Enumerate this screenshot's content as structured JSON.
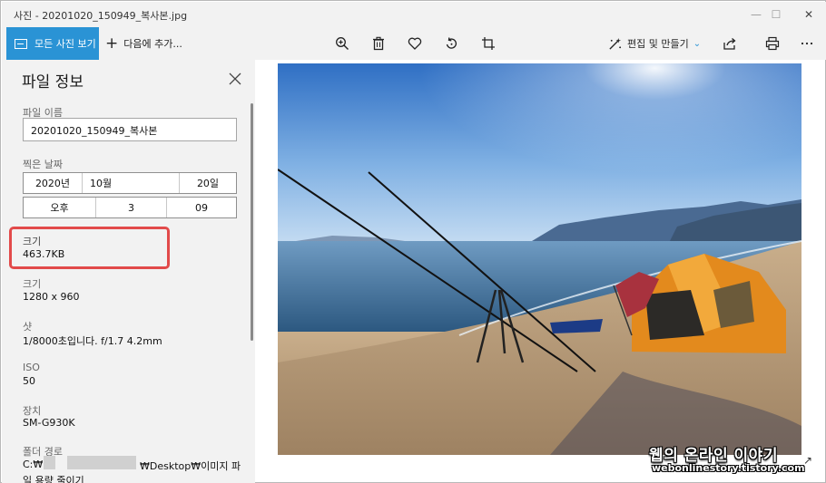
{
  "window": {
    "title": "사진 - 20201020_150949_복사본.jpg",
    "minimize_glyph": "—",
    "maximize_glyph": "☐",
    "close_glyph": "✕"
  },
  "toolbar": {
    "all_photos_label": "모든 사진 보기",
    "add_label": "다음에 추가...",
    "edit_label": "편집 및 만들기",
    "icons": [
      "zoom-icon",
      "delete-icon",
      "favorite-heart-icon",
      "rotate-icon",
      "crop-icon",
      "edit-create-icon",
      "share-icon",
      "print-icon",
      "more-icon"
    ],
    "accent": "#2a93d5"
  },
  "info_panel": {
    "title": "파일 정보",
    "file_name": {
      "label": "파일 이름",
      "value": "20201020_150949_복사본"
    },
    "date_taken": {
      "label": "찍은 날짜",
      "year": "2020년",
      "month": "10월",
      "day": "20일",
      "ampm": "오후",
      "hour": "3",
      "minute": "09"
    },
    "file_size": {
      "label": "크기",
      "value": "463.7KB"
    },
    "dimensions": {
      "label": "크기",
      "value": "1280 x 960"
    },
    "shot": {
      "label": "샷",
      "value": "1/8000초입니다. f/1.7 4.2mm"
    },
    "iso": {
      "label": "ISO",
      "value": "50"
    },
    "device": {
      "label": "장치",
      "value": "SM-G930K"
    },
    "folder": {
      "label": "폴더 경로",
      "path_start": "C:₩",
      "path_end": "₩Desktop₩이미지 파",
      "path_line2": "일 용량 줄이기"
    },
    "highlight_color": "#e24a4a"
  },
  "watermark": {
    "line1": "웹의 온라인 이야기",
    "line2": "webonlinestory.tistory.com"
  },
  "expand_glyph": "↗"
}
